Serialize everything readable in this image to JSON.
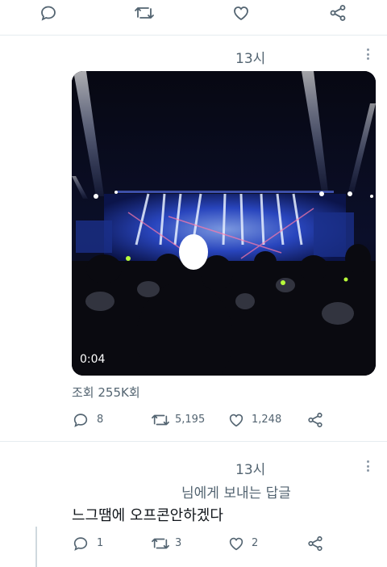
{
  "top_actions": {
    "reply_icon": "reply-bubble-icon",
    "retweet_icon": "retweet-icon",
    "like_icon": "heart-icon",
    "share_icon": "share-icon"
  },
  "tweet1": {
    "time": "13시",
    "video": {
      "duration": "0:04",
      "description": "concert stage with blue light beams and audience"
    },
    "views": "조회 255K회",
    "actions": {
      "replies": "8",
      "retweets": "5,195",
      "likes": "1,248"
    }
  },
  "tweet2": {
    "time": "13시",
    "reply_context": "님에게 보내는 답글",
    "text": "느그땜에 오프콘안하겠다",
    "actions": {
      "replies": "1",
      "retweets": "3",
      "likes": "2"
    }
  },
  "colors": {
    "icon_gray": "#536471",
    "divider": "#e6ecf0",
    "stage_blue": "#3a6cff"
  }
}
